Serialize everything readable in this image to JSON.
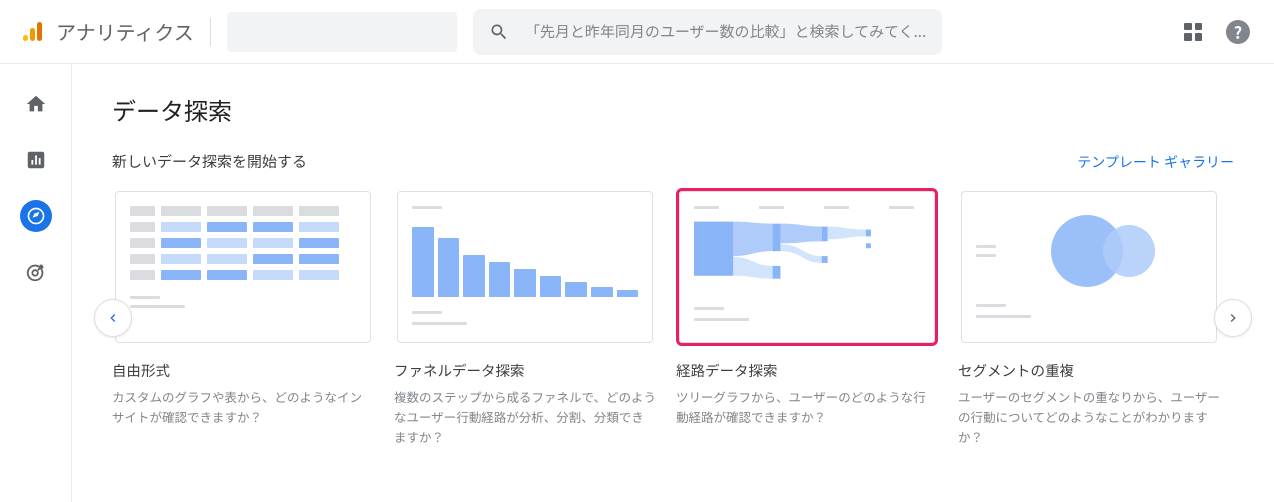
{
  "header": {
    "app_title": "アナリティクス",
    "search_placeholder": "「先月と昨年同月のユーザー数の比較」と検索してみてく..."
  },
  "page": {
    "title": "データ探索",
    "subtitle": "新しいデータ探索を開始する",
    "gallery_link": "テンプレート ギャラリー"
  },
  "cards": [
    {
      "title": "自由形式",
      "description": "カスタムのグラフや表から、どのようなインサイトが確認できますか？"
    },
    {
      "title": "ファネルデータ探索",
      "description": "複数のステップから成るファネルで、どのようなユーザー行動経路が分析、分割、分類できますか？"
    },
    {
      "title": "経路データ探索",
      "description": "ツリーグラフから、ユーザーのどのような行動経路が確認できますか？"
    },
    {
      "title": "セグメントの重複",
      "description": "ユーザーのセグメントの重なりから、ユーザーの行動についてどのようなことがわかりますか？"
    }
  ]
}
